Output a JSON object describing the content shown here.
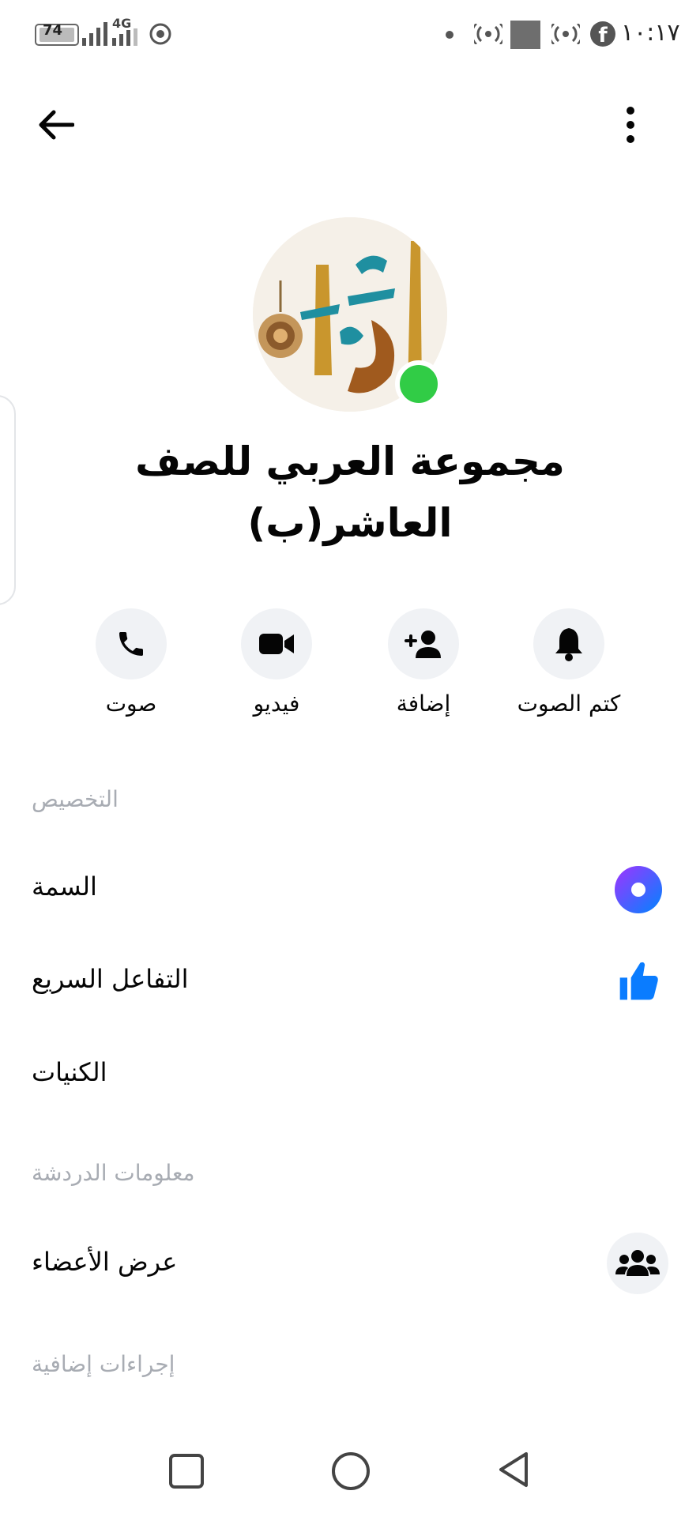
{
  "status_bar": {
    "time": "١٠:١٧",
    "battery": "74",
    "network": "4G"
  },
  "header": {
    "back_icon": "arrow-left-icon",
    "more_icon": "vertical-dots-icon"
  },
  "group": {
    "name_line1": "مجموعة العربي للصف",
    "name_line2": "العاشر(ب)",
    "online": true
  },
  "actions": [
    {
      "label": "صوت",
      "icon": "phone-icon"
    },
    {
      "label": "فيديو",
      "icon": "video-icon"
    },
    {
      "label": "إضافة",
      "icon": "add-person-icon"
    },
    {
      "label": "كتم الصوت",
      "icon": "bell-icon"
    }
  ],
  "sections": {
    "customization": "التخصيص",
    "chat_info": "معلومات الدردشة",
    "more_actions": "إجراءات إضافية"
  },
  "rows": {
    "theme": "السمة",
    "quick_reaction": "التفاعل السريع",
    "nicknames": "الكنيات",
    "view_members": "عرض الأعضاء"
  },
  "colors": {
    "theme_accent_start": "#a033ff",
    "theme_accent_end": "#0084ff",
    "like_blue": "#0a7cff",
    "online_green": "#31cc46"
  }
}
